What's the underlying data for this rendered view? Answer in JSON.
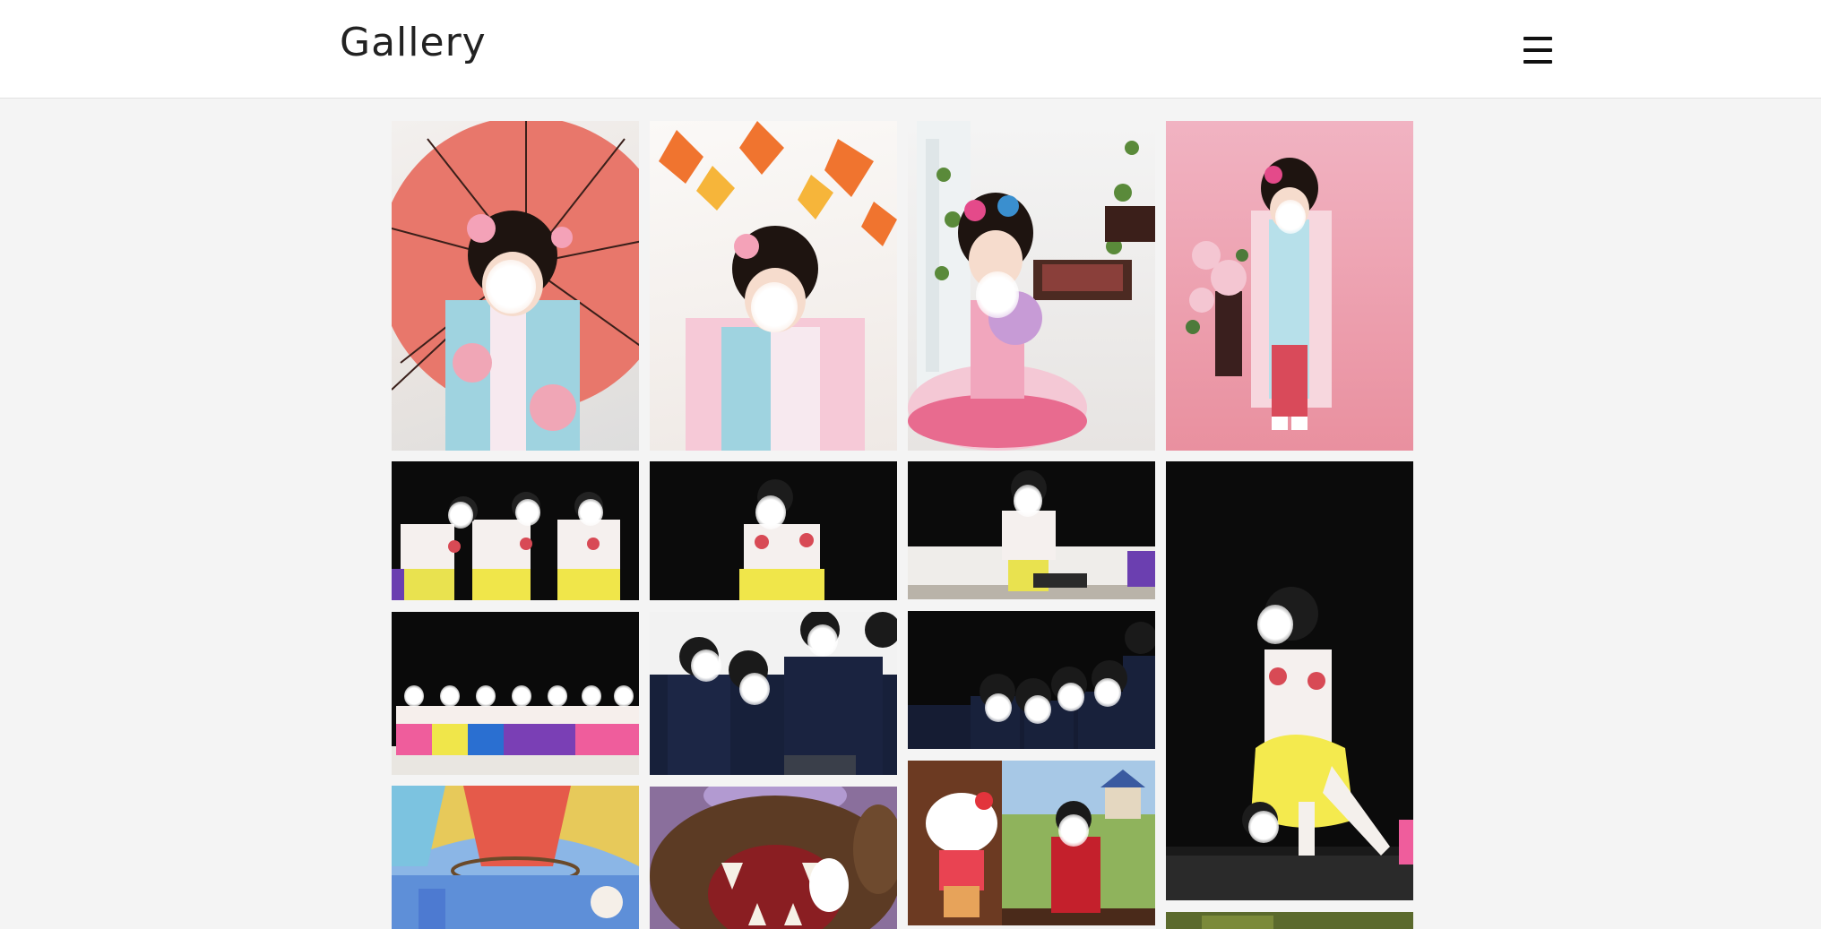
{
  "header": {
    "title": "Gallery",
    "menu_icon": "hamburger-menu-icon"
  },
  "gallery": {
    "photos": [
      {
        "id": "photo-1",
        "subject": "parasol-kimono"
      },
      {
        "id": "photo-2",
        "subject": "maple-kimono"
      },
      {
        "id": "photo-3",
        "subject": "dress-window"
      },
      {
        "id": "photo-4",
        "subject": "pink-kimono-standing"
      },
      {
        "id": "photo-5",
        "subject": "stage-dance-group"
      },
      {
        "id": "photo-6",
        "subject": "stage-dance-solo"
      },
      {
        "id": "photo-7",
        "subject": "stage-podium"
      },
      {
        "id": "photo-8",
        "subject": "stage-dancer-jump"
      },
      {
        "id": "photo-9",
        "subject": "stage-line-colors"
      },
      {
        "id": "photo-10",
        "subject": "uniform-children"
      },
      {
        "id": "photo-11",
        "subject": "uniform-row"
      },
      {
        "id": "photo-12",
        "subject": "balloon-art"
      },
      {
        "id": "photo-13",
        "subject": "bear-mouth-art"
      },
      {
        "id": "photo-14",
        "subject": "kitty-painting"
      },
      {
        "id": "photo-15",
        "subject": "forest-art"
      }
    ]
  }
}
